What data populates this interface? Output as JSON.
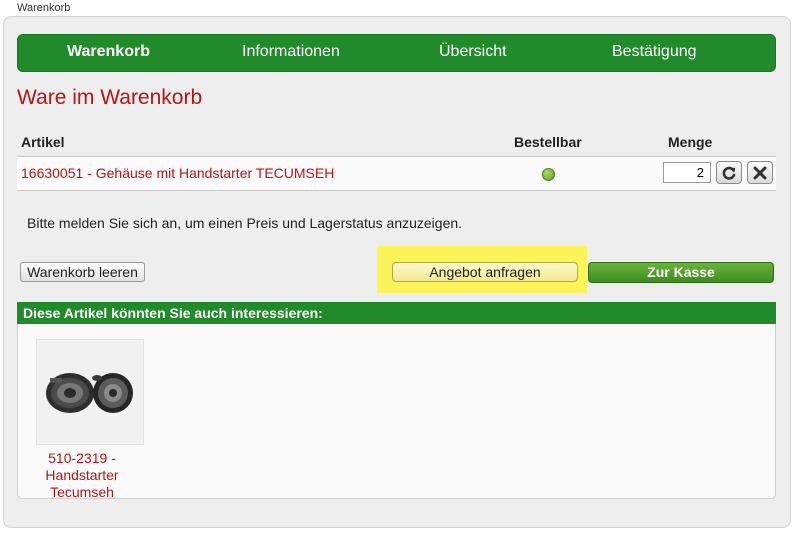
{
  "window": {
    "tab_label": "Warenkorb"
  },
  "nav": {
    "items": [
      {
        "label": "Warenkorb",
        "active": true
      },
      {
        "label": "Informationen",
        "active": false
      },
      {
        "label": "Übersicht",
        "active": false
      },
      {
        "label": "Bestätigung",
        "active": false
      }
    ]
  },
  "page": {
    "title": "Ware im Warenkorb"
  },
  "cart": {
    "headers": {
      "article": "Artikel",
      "available": "Bestellbar",
      "quantity": "Menge"
    },
    "items": [
      {
        "name": "16630051 - Gehäuse mit Handstarter TECUMSEH",
        "available": true,
        "quantity": "2"
      }
    ],
    "info": "Bitte melden Sie sich an, um einen Preis und Lagerstatus anzuzeigen.",
    "buttons": {
      "clear": "Warenkorb leeren",
      "quote": "Angebot anfragen",
      "checkout": "Zur Kasse"
    }
  },
  "recommendations": {
    "heading": "Diese Artikel könnten Sie auch interessieren:",
    "items": [
      {
        "name": "510-2319 - Handstarter Tecumseh"
      }
    ]
  },
  "icons": {
    "refresh": "refresh-icon",
    "remove": "close-icon",
    "availability": "status-dot-icon"
  },
  "colors": {
    "brand_green": "#218a2b",
    "link_red": "#b81414",
    "highlight_yellow": "#fbf55a",
    "checkout_green": "#4f9e2a"
  }
}
